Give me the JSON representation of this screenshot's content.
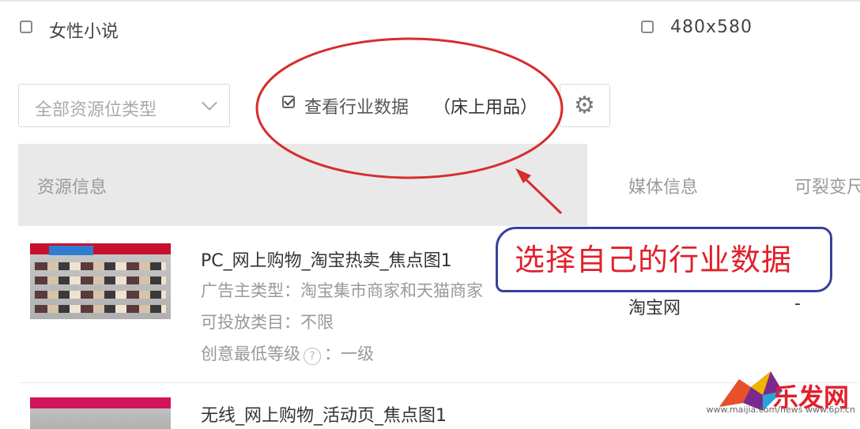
{
  "filters": {
    "genre_option": "女性小说",
    "size_option": "480x580"
  },
  "toolbar": {
    "resource_type_select": "全部资源位类型",
    "industry_toggle_label": "查看行业数据",
    "industry_value": "（床上用品）",
    "settings_icon": "gear-icon"
  },
  "table": {
    "headers": [
      "资源信息",
      "媒体信息",
      "可裂变尺"
    ],
    "rows": [
      {
        "title": "PC_网上购物_淘宝热卖_焦点图1",
        "advertiser_type": "广告主类型：淘宝集市商家和天猫商家",
        "category": "可投放类目：不限",
        "min_level_label": "创意最低等级",
        "min_level_value": "：一级",
        "media": "淘宝网",
        "resizable": "-"
      },
      {
        "title": "无线_网上购物_活动页_焦点图1"
      }
    ]
  },
  "annotation": {
    "callout_text": "选择自己的行业数据",
    "circle_color": "#d62d2d",
    "box_color": "#3a3f9e",
    "text_color": "#e1202a"
  },
  "watermark": {
    "logo_text": "乐发网",
    "url_text": "www.maijia.com/news   www.6pf.cn"
  }
}
